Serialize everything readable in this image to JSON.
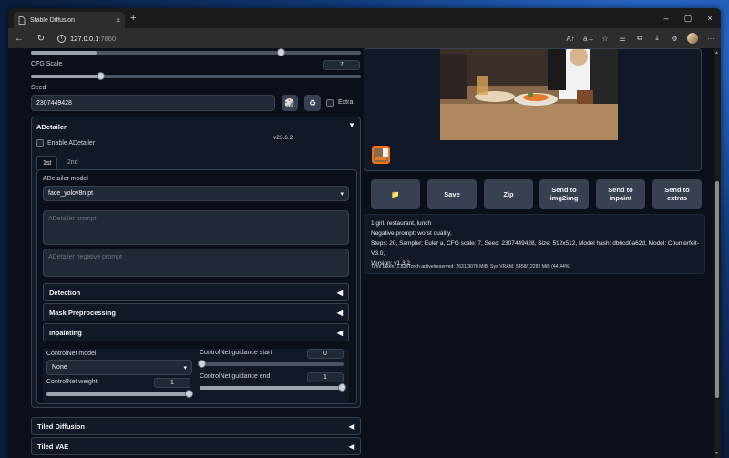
{
  "browser": {
    "tab_title": "Stable Diffusion",
    "url_host": "127.0.0.1",
    "url_port": ":7860"
  },
  "icons": {
    "back": "←",
    "refresh": "↻",
    "info": "i",
    "tab_close": "×",
    "new_tab": "+",
    "minimize": "–",
    "maximize": "▢",
    "close": "×",
    "read_aloud": "A↑",
    "translate": "a→",
    "favorite": "☆",
    "favorites_bar": "☰",
    "collections": "⧉",
    "downloads": "⤓",
    "extensions": "⚙",
    "more": "···",
    "dice": "🎲",
    "recycle": "♻",
    "folder": "📁",
    "collapse_open": "▼",
    "collapse_closed": "◀",
    "dropdown": "▾"
  },
  "cfg": {
    "label": "CFG Scale",
    "value": "7",
    "fraction": 0.2
  },
  "top_slider": {
    "fraction": 0.2
  },
  "seed": {
    "label": "Seed",
    "value": "2307449428",
    "extra_label": "Extra"
  },
  "adetailer": {
    "title": "ADetailer",
    "enable_label": "Enable ADetailer",
    "version": "v23.6.2",
    "tabs": [
      "1st",
      "2nd"
    ],
    "model_label": "ADetailer model",
    "model_value": "face_yolov8n.pt",
    "prompt_placeholder": "ADetailer prompt",
    "negative_placeholder": "ADetailer negative prompt",
    "sections": [
      "Detection",
      "Mask Preprocessing",
      "Inpainting"
    ],
    "controlnet": {
      "model_label": "ControlNet model",
      "model_value": "None",
      "weight_label": "ControlNet weight",
      "weight_value": "1",
      "weight_fraction": 1.0,
      "start_label": "ControlNet guidance start",
      "start_value": "0",
      "start_fraction": 0.0,
      "end_label": "ControlNet guidance end",
      "end_value": "1",
      "end_fraction": 1.0
    }
  },
  "collapsed_sections": [
    "Tiled Diffusion",
    "Tiled VAE"
  ],
  "output": {
    "buttons": {
      "save": "Save",
      "zip": "Zip",
      "img2img": "Send to\nimg2img",
      "inpaint": "Send to\ninpaint",
      "extras": "Send to\nextras"
    },
    "prompt_line": "1 girl, restaurant, lunch",
    "negative_line": "Negative prompt: worst quality,",
    "params_line1": "Steps: 20, Sampler: Euler a, CFG scale: 7, Seed: 2307449428, Size: 512x512, Model hash: db6cd0a62d, Model: Counterfeit-V3.0,",
    "params_line2": "Version: v1.3.2",
    "time_line": "Time taken: 1.83sTorch active/reserved: 2631/3078 MiB, Sys VRAM: 5458/12282 MiB (44.44%)"
  }
}
